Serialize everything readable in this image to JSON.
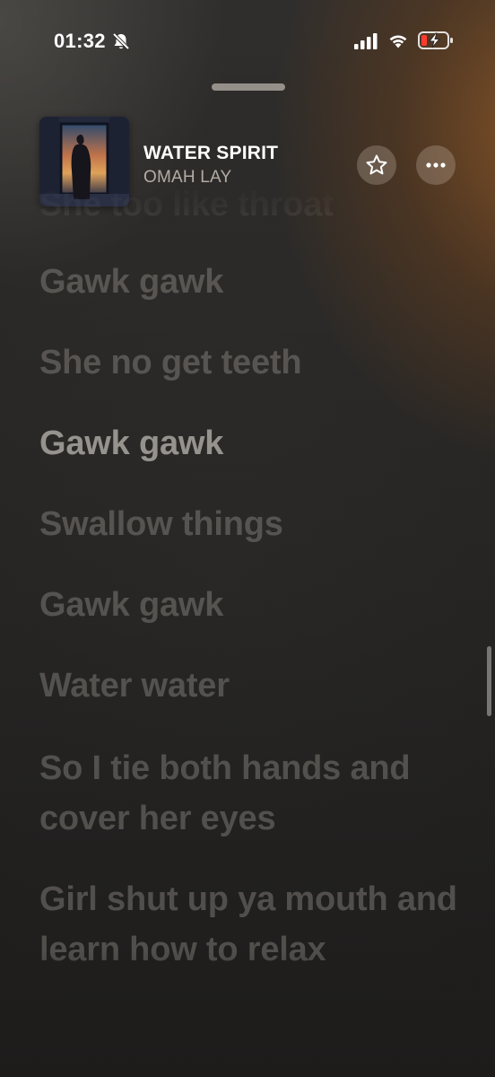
{
  "status_bar": {
    "time": "01:32",
    "silent_icon": "bell-slash-icon",
    "signal_icon": "cellular-signal-icon",
    "wifi_icon": "wifi-icon",
    "battery_icon": "battery-low-charging-icon"
  },
  "now_playing": {
    "title": "WATER SPIRIT",
    "artist": "OMAH LAY",
    "favorite_icon": "star-icon",
    "more_icon": "ellipsis-icon"
  },
  "lyrics": [
    "She too like throat",
    "Gawk gawk",
    "She no get teeth",
    "Gawk gawk",
    "Swallow things",
    "Gawk gawk",
    "Water water",
    "So I tie both hands and cover her eyes",
    "Girl shut up ya mouth and learn how to relax"
  ],
  "current_lyric_index": 3,
  "colors": {
    "accent_warm": "#915826",
    "text_primary": "#ffffff",
    "battery_low": "#ff3b30"
  }
}
